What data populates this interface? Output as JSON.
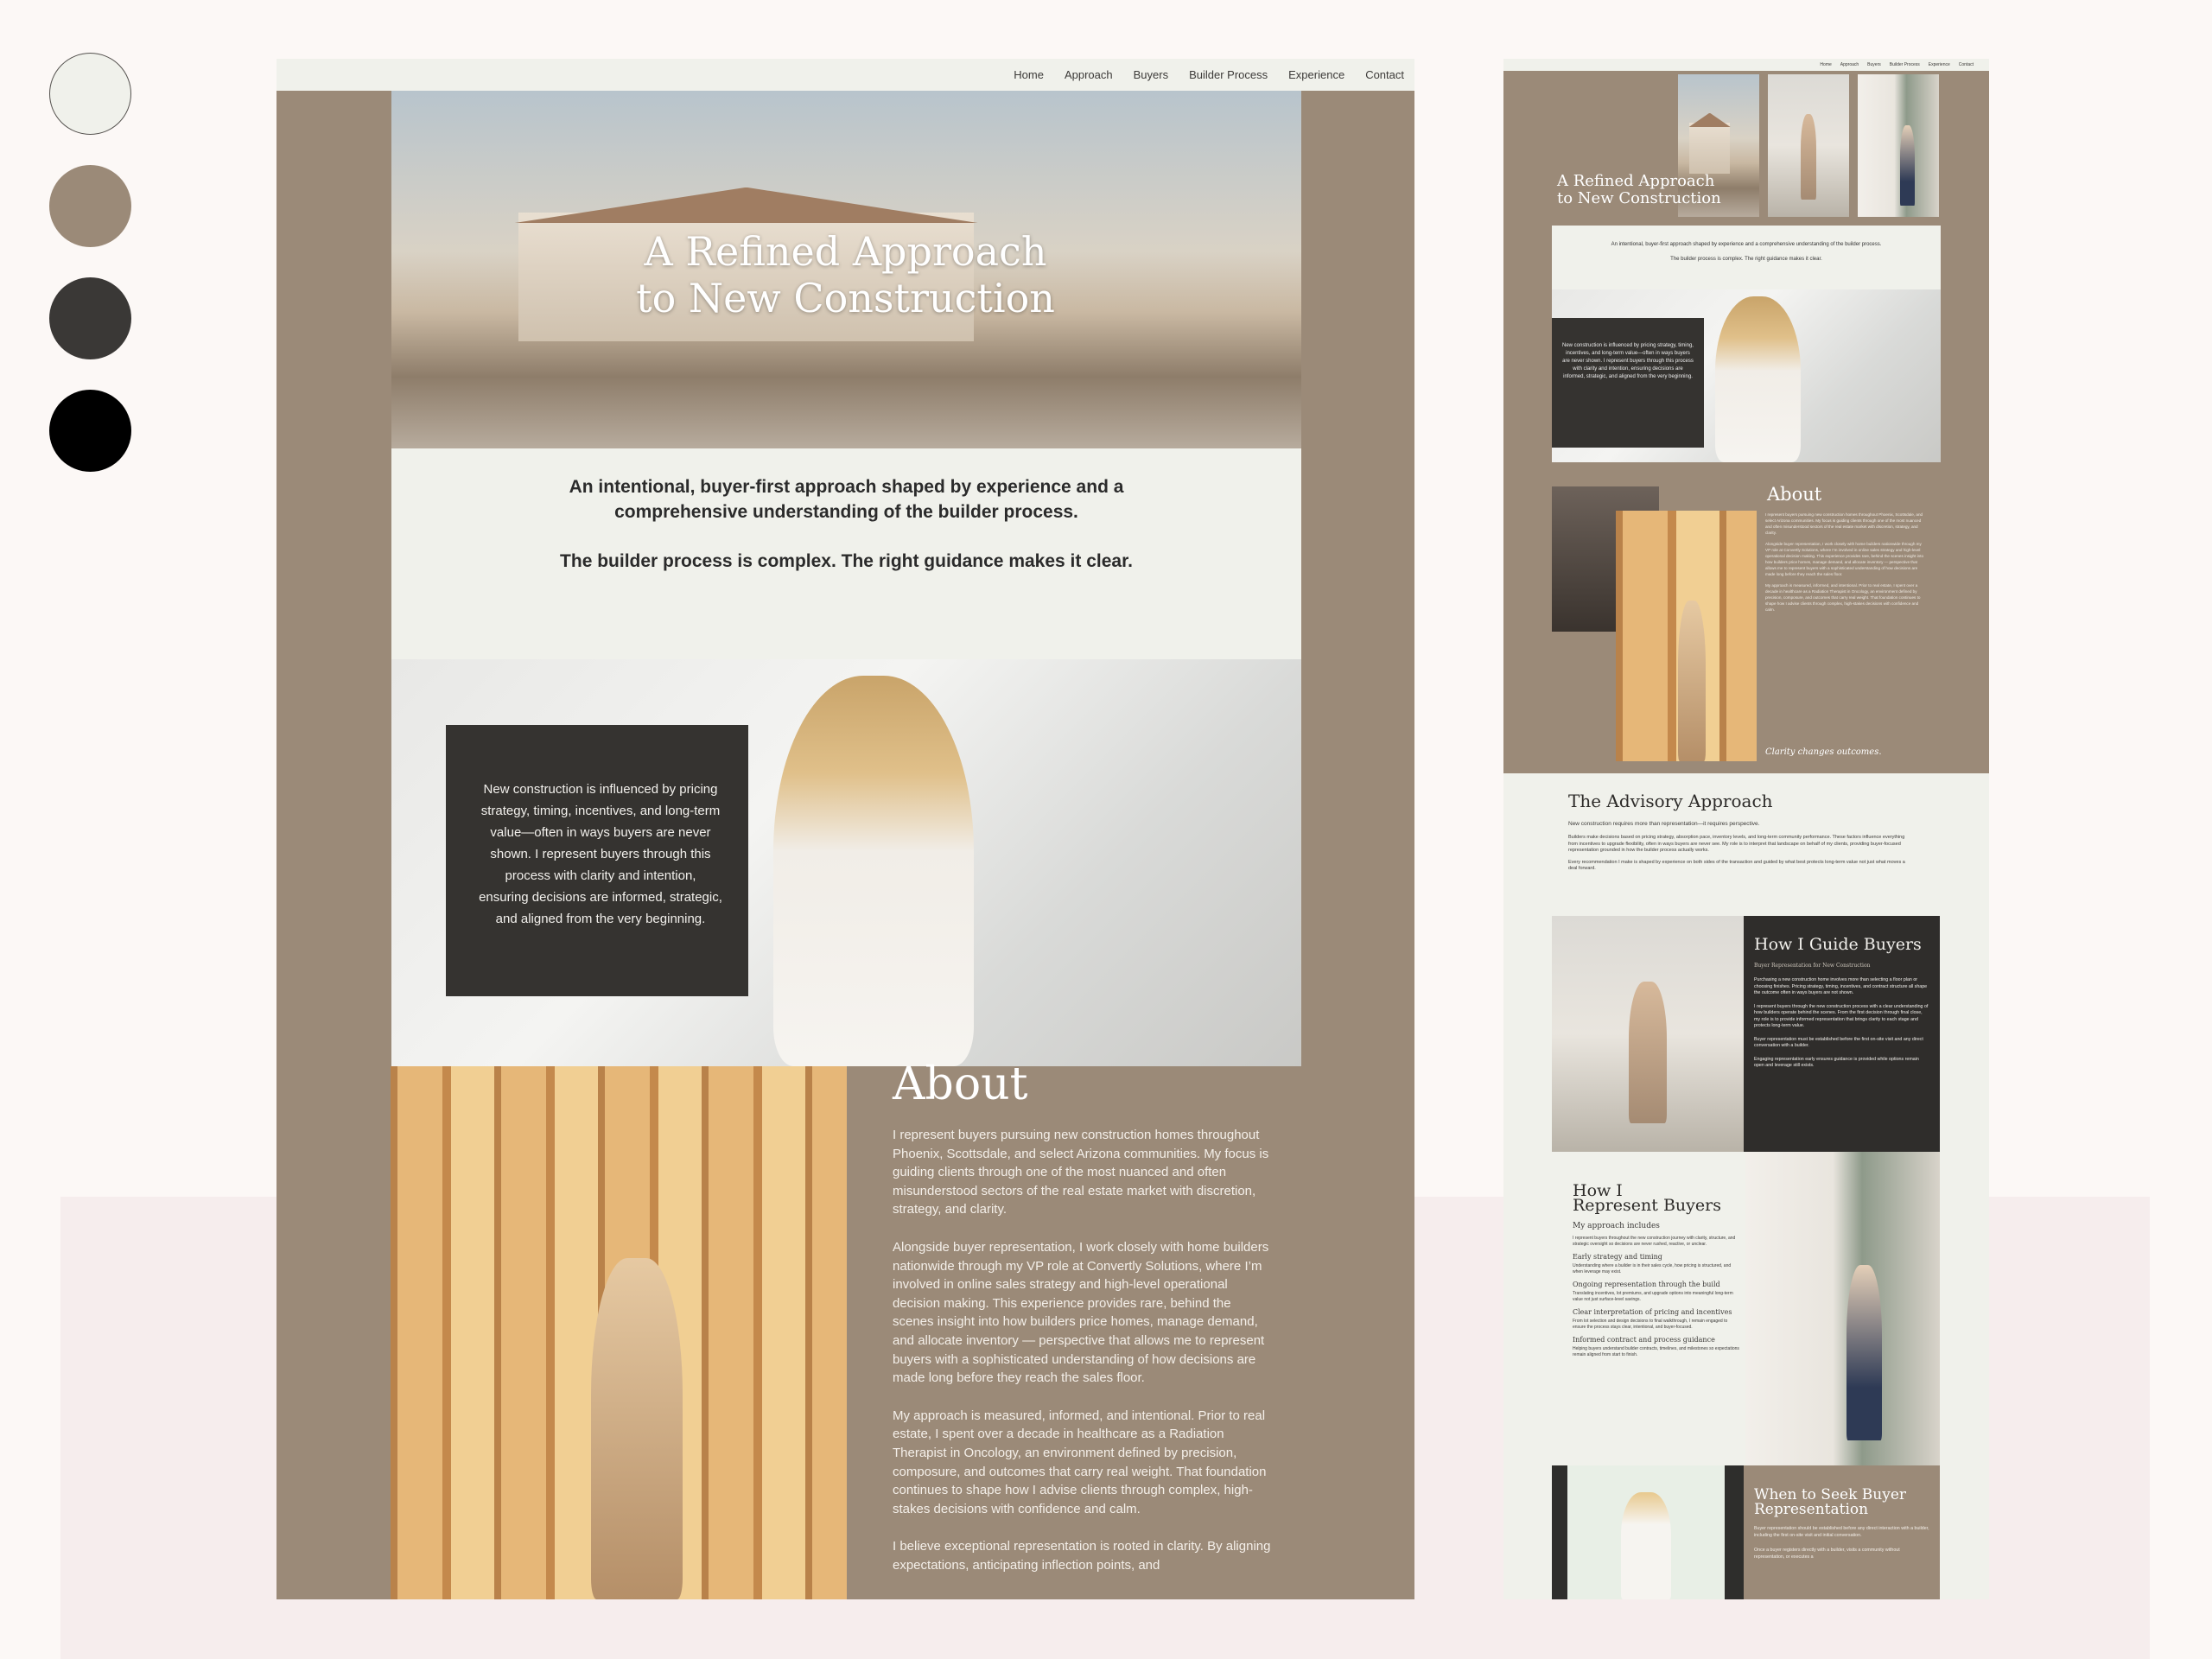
{
  "palette": [
    "#f0f1eb",
    "#9b8a78",
    "#3a3836",
    "#000000"
  ],
  "nav": [
    "Home",
    "Approach",
    "Buyers",
    "Builder Process",
    "Experience",
    "Contact"
  ],
  "hero": {
    "title_line1": "A Refined Approach",
    "title_line2": "to New Construction"
  },
  "intro": {
    "line1": "An intentional, buyer-first approach shaped by experience and a comprehensive understanding of the builder process.",
    "line2": "The builder process is complex. The right guidance makes it clear."
  },
  "feature": {
    "text": "New construction is influenced by pricing strategy, timing, incentives, and long-term value—often in ways buyers are never shown. I represent buyers through this process with clarity and intention, ensuring decisions are informed, strategic, and aligned from the very beginning."
  },
  "about": {
    "title": "About",
    "p1": "I represent buyers pursuing new construction homes throughout Phoenix, Scottsdale, and select Arizona communities. My focus is guiding clients through one of the most nuanced and often misunderstood sectors of the real estate market with discretion, strategy, and clarity.",
    "p2": "Alongside buyer representation, I work closely with home builders nationwide through my VP role at Convertly Solutions, where I’m involved in online sales strategy and high-level operational decision making. This experience provides rare, behind the scenes insight into how builders price homes, manage demand, and allocate inventory — perspective that allows me to represent buyers with a sophisticated understanding of how decisions are made long before they reach the sales floor.",
    "p3": "My approach is measured, informed, and intentional. Prior to real estate, I spent over a decade in healthcare as a Radiation Therapist in Oncology, an environment defined by precision, composure, and outcomes that carry real weight. That foundation continues to shape how I advise clients through complex, high-stakes decisions with confidence and calm.",
    "p4": "I believe exceptional representation is rooted in clarity. By aligning expectations, anticipating inflection points, and",
    "closing": "Clarity changes outcomes."
  },
  "advisory": {
    "title": "The Advisory Approach",
    "subtitle": "New construction requires more than representation—it requires perspective.",
    "p1": "Builders make decisions based on pricing strategy, absorption pace, inventory levels, and long-term community performance. These factors influence everything from incentives to upgrade flexibility, often in ways buyers are never see. My role is to interpret that landscape on behalf of my clients, providing buyer-focused representation grounded in how the builder process actually works.",
    "p2": "Every recommendation I make is shaped by experience on both sides of the transaction and guided by what best protects long-term value not just what moves a deal forward."
  },
  "guide": {
    "title": "How I Guide Buyers",
    "subtitle": "Buyer Representation for New Construction",
    "p1": "Purchasing a new construction home involves more than selecting a floor plan or choosing finishes. Pricing strategy, timing, incentives, and contract structure all shape the outcome often in ways buyers are not shown.",
    "p2": "I represent buyers through the new construction process with a clear understanding of how builders operate behind the scenes. From the first decision through final close, my role is to provide informed representation that brings clarity to each stage and protects long-term value.",
    "p3": "Buyer representation must be established before the first on-site visit and any direct conversation with a builder.",
    "p4": "Engaging representation early ensures guidance is provided while options remain open and leverage still exists."
  },
  "represent": {
    "title_line1": "How I",
    "title_line2": "Represent Buyers",
    "subtitle": "My approach includes",
    "intro": "I represent buyers throughout the new construction journey with clarity, structure, and strategic oversight so decisions are never rushed, reactive, or unclear.",
    "items": [
      {
        "heading": "Early strategy and timing",
        "body": "Understanding where a builder is in their sales cycle, how pricing is structured, and when leverage may exist."
      },
      {
        "heading": "Ongoing representation through the build",
        "body": "Translating incentives, lot premiums, and upgrade options into meaningful long-term value not just surface-level savings."
      },
      {
        "heading": "Clear interpretation of pricing and incentives",
        "body": "From lot selection and design decisions to final walkthrough, I remain engaged to ensure the process stays clear, intentional, and buyer-focused."
      },
      {
        "heading": "Informed contract and process guidance",
        "body": "Helping buyers understand builder contracts, timelines, and milestones so expectations remain aligned from start to finish."
      }
    ]
  },
  "when": {
    "title_line1": "When to Seek Buyer",
    "title_line2": "Representation",
    "p1": "Buyer representation should be established before any direct interaction with a builder, including the first on-site visit and initial conversation.",
    "p2": "Once a buyer registers directly with a builder, visits a community without representation, or executes a"
  }
}
